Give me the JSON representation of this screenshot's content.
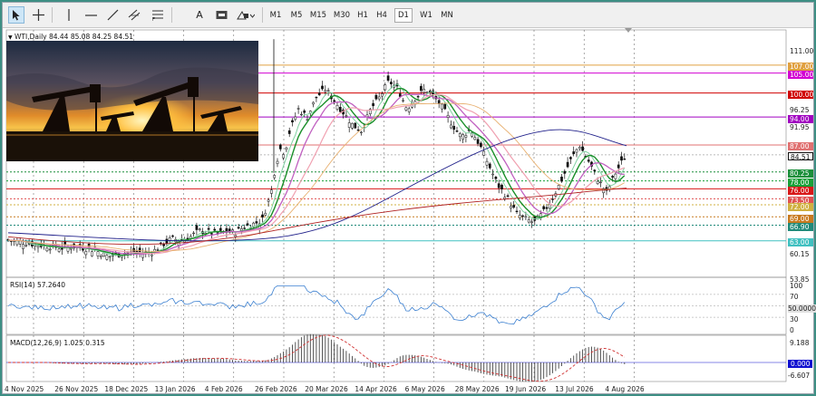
{
  "toolbar": {
    "timeframes": [
      "M1",
      "M5",
      "M15",
      "M30",
      "H1",
      "H4",
      "D1",
      "W1",
      "MN"
    ],
    "active_timeframe": "D1",
    "text_tool": "A",
    "tools": [
      "cursor-icon",
      "crosshair-icon",
      "vertical-line-icon",
      "horizontal-line-icon",
      "trend-line-icon",
      "channel-icon",
      "fibonacci-icon",
      "text-icon",
      "label-icon",
      "shapes-icon"
    ]
  },
  "symbol": {
    "name": "WTI,Daily",
    "ohlc": "84.44 85.08 84.25 84.51"
  },
  "price_levels": [
    {
      "label": "111.00",
      "style": "tick"
    },
    {
      "label": "107.00",
      "style": "tag",
      "color": "#e0a040"
    },
    {
      "label": "105.00",
      "style": "tag",
      "color": "#d200d2"
    },
    {
      "label": "100.00",
      "style": "tag",
      "color": "#d00000"
    },
    {
      "label": "96.25",
      "style": "tick"
    },
    {
      "label": "94.00",
      "style": "tag",
      "color": "#a000c0"
    },
    {
      "label": "91.95",
      "style": "tick"
    },
    {
      "label": "87.00",
      "style": "tag",
      "color": "#e07070"
    },
    {
      "label": "84.51",
      "style": "tag",
      "color": "#1a1a1a"
    },
    {
      "label": "80.25",
      "style": "tag",
      "color": "#1a8f3a"
    },
    {
      "label": "78.00",
      "style": "tag",
      "color": "#18a038"
    },
    {
      "label": "76.00",
      "style": "tag",
      "color": "#d81818"
    },
    {
      "label": "73.50",
      "style": "tag",
      "color": "#e05050"
    },
    {
      "label": "72.00",
      "style": "tag",
      "color": "#d0b040"
    },
    {
      "label": "69.00",
      "style": "tag",
      "color": "#c87a20"
    },
    {
      "label": "66.90",
      "style": "tag",
      "color": "#208a7a"
    },
    {
      "label": "63.00",
      "style": "tag",
      "color": "#40c0c0"
    },
    {
      "label": "60.15",
      "style": "tick"
    },
    {
      "label": "53.85",
      "style": "tick"
    }
  ],
  "rsi": {
    "title": "RSI(14) 57.2640",
    "value": 57.264,
    "levels": [
      "100",
      "70",
      "50.0000",
      "30",
      "0"
    ]
  },
  "macd": {
    "title": "MACD(12,26,9) 1.025 0.315",
    "macd": 1.025,
    "signal": 0.315,
    "levels": [
      "9.188",
      "0.000",
      "-6.607"
    ]
  },
  "dates": [
    "4 Nov 2025",
    "26 Nov 2025",
    "18 Dec 2025",
    "13 Jan 2026",
    "4 Feb 2026",
    "26 Feb 2026",
    "20 Mar 2026",
    "14 Apr 2026",
    "6 May 2026",
    "28 May 2026",
    "19 Jun 2026",
    "13 Jul 2026",
    "4 Aug 2026"
  ],
  "chart_data": {
    "type": "candlestick",
    "ylim": [
      53.85,
      114
    ],
    "close_path": [
      [
        0,
        63.2
      ],
      [
        10,
        62.8
      ],
      [
        20,
        62.5
      ],
      [
        30,
        62.0
      ],
      [
        40,
        61.8
      ],
      [
        50,
        61.5
      ],
      [
        60,
        61.2
      ],
      [
        70,
        61.6
      ],
      [
        80,
        61.3
      ],
      [
        90,
        61.0
      ],
      [
        100,
        60.2
      ],
      [
        110,
        59.0
      ],
      [
        120,
        59.5
      ],
      [
        130,
        60.1
      ],
      [
        140,
        60.0
      ],
      [
        150,
        59.9
      ],
      [
        160,
        60.3
      ],
      [
        170,
        62.0
      ],
      [
        180,
        63.5
      ],
      [
        190,
        63.2
      ],
      [
        200,
        63.8
      ],
      [
        210,
        65.5
      ],
      [
        220,
        65.2
      ],
      [
        230,
        64.8
      ],
      [
        240,
        65.3
      ],
      [
        250,
        65.0
      ],
      [
        260,
        66.5
      ],
      [
        270,
        67.2
      ],
      [
        280,
        68.0
      ],
      [
        290,
        75.0
      ],
      [
        295,
        82.0
      ],
      [
        300,
        86.0
      ],
      [
        305,
        85.0
      ],
      [
        310,
        90.0
      ],
      [
        320,
        96.0
      ],
      [
        330,
        94.0
      ],
      [
        340,
        99.0
      ],
      [
        350,
        101.0
      ],
      [
        360,
        98.0
      ],
      [
        370,
        95.0
      ],
      [
        380,
        92.0
      ],
      [
        390,
        90.5
      ],
      [
        400,
        96.0
      ],
      [
        410,
        99.0
      ],
      [
        420,
        103.0
      ],
      [
        430,
        101.0
      ],
      [
        440,
        96.0
      ],
      [
        450,
        99.0
      ],
      [
        460,
        101.0
      ],
      [
        470,
        99.0
      ],
      [
        480,
        96.0
      ],
      [
        490,
        92.0
      ],
      [
        500,
        89.0
      ],
      [
        510,
        91.0
      ],
      [
        520,
        87.0
      ],
      [
        530,
        82.0
      ],
      [
        540,
        77.0
      ],
      [
        550,
        74.0
      ],
      [
        560,
        70.0
      ],
      [
        570,
        68.5
      ],
      [
        580,
        67.5
      ],
      [
        590,
        70.0
      ],
      [
        600,
        73.5
      ],
      [
        610,
        78.0
      ],
      [
        620,
        83.0
      ],
      [
        630,
        87.0
      ],
      [
        640,
        83.0
      ],
      [
        650,
        78.5
      ],
      [
        660,
        75.0
      ],
      [
        670,
        80.0
      ],
      [
        680,
        84.0
      ],
      [
        690,
        84.51
      ]
    ]
  }
}
